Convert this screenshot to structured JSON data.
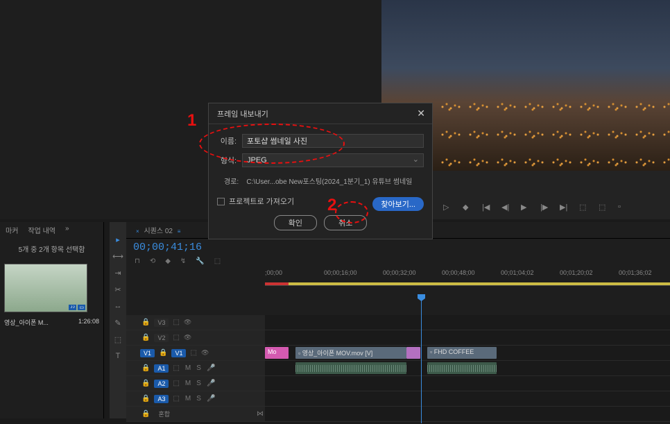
{
  "dialog": {
    "title": "프레임 내보내기",
    "name_label": "이름:",
    "name_value": "포토샵 썸네일 사진",
    "format_label": "형식:",
    "format_value": "JPEG",
    "path_label": "경로:",
    "path_value": "C:\\User...obe New포스팅(2024_1분기_1) 유튜브 썸네일",
    "import_checkbox": "프로젝트로 가져오기",
    "browse_btn": "찾아보기...",
    "ok_btn": "확인",
    "cancel_btn": "취소"
  },
  "annotations": {
    "num1": "1",
    "num2": "2"
  },
  "project": {
    "tab_marker": "마커",
    "tab_history": "작업 내역",
    "selection_info": "5개 중 2개 항목 선택함",
    "clip_name": "영상_아이폰 M...",
    "clip_duration": "1:26:08"
  },
  "timeline": {
    "sequence_name": "시퀀스 02",
    "timecode": "00;00;41;16",
    "ticks": [
      {
        "label": ";00;00",
        "pos": 0
      },
      {
        "label": "00;00;16;00",
        "pos": 85
      },
      {
        "label": "00;00;32;00",
        "pos": 170
      },
      {
        "label": "00;00;48;00",
        "pos": 255
      },
      {
        "label": "00;01;04;02",
        "pos": 340
      },
      {
        "label": "00;01;20;02",
        "pos": 425
      },
      {
        "label": "00;01;36;02",
        "pos": 510
      }
    ],
    "tracks": {
      "v3": "V3",
      "v2": "V2",
      "v1": "V1",
      "a1": "A1",
      "a2": "A2",
      "a3": "A3",
      "mix": "혼합"
    },
    "clips": {
      "pink": "Mo",
      "video1": "영상_아이폰 MOV.mov [V]",
      "video2": "FHD COFFEE"
    },
    "ms_m": "M",
    "ms_s": "S"
  }
}
